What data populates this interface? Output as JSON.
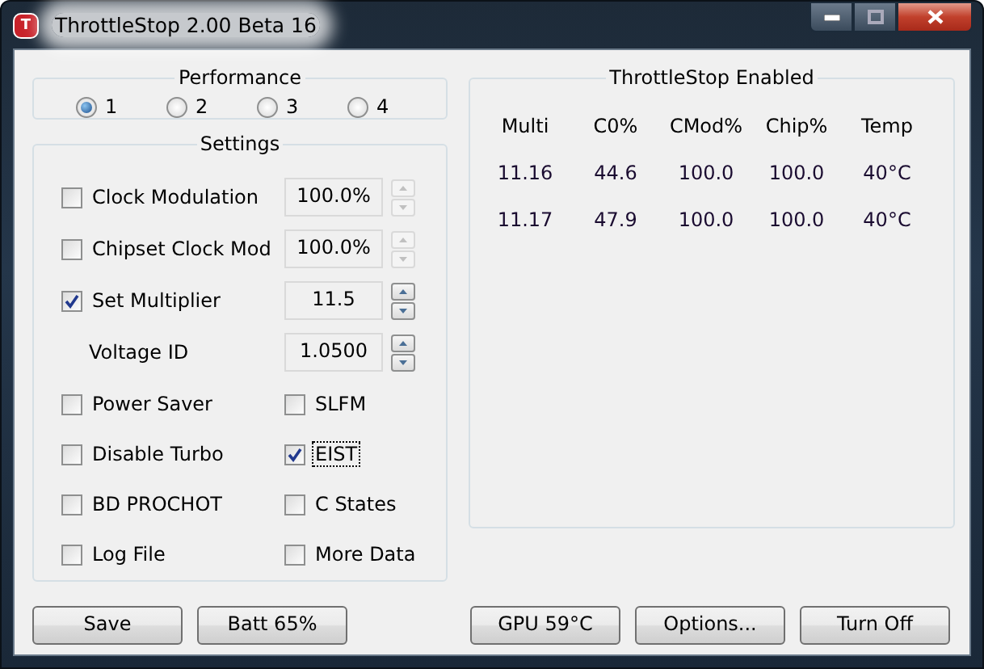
{
  "window": {
    "title": "ThrottleStop 2.00 Beta 16",
    "app_icon_text": "T"
  },
  "performance": {
    "title": "Performance",
    "options": [
      {
        "label": "1",
        "selected": true
      },
      {
        "label": "2",
        "selected": false
      },
      {
        "label": "3",
        "selected": false
      },
      {
        "label": "4",
        "selected": false
      }
    ]
  },
  "settings": {
    "title": "Settings",
    "rows": [
      {
        "kind": "checkbox",
        "label": "Clock Modulation",
        "checked": false,
        "value": "100.0%",
        "spinner_enabled": false
      },
      {
        "kind": "checkbox",
        "label": "Chipset Clock Mod",
        "checked": false,
        "value": "100.0%",
        "spinner_enabled": false
      },
      {
        "kind": "checkbox",
        "label": "Set Multiplier",
        "checked": true,
        "value": "11.5",
        "spinner_enabled": true
      },
      {
        "kind": "label",
        "label": "Voltage ID",
        "value": "1.0500",
        "spinner_enabled": true
      }
    ],
    "toggles": [
      {
        "label": "Power Saver",
        "checked": false,
        "focused": false
      },
      {
        "label": "SLFM",
        "checked": false,
        "focused": false
      },
      {
        "label": "Disable Turbo",
        "checked": false,
        "focused": false
      },
      {
        "label": "EIST",
        "checked": true,
        "focused": true
      },
      {
        "label": "BD PROCHOT",
        "checked": false,
        "focused": false
      },
      {
        "label": "C States",
        "checked": false,
        "focused": false
      },
      {
        "label": "Log File",
        "checked": false,
        "focused": false
      },
      {
        "label": "More Data",
        "checked": false,
        "focused": false
      }
    ]
  },
  "status": {
    "title": "ThrottleStop Enabled",
    "columns": [
      "Multi",
      "C0%",
      "CMod%",
      "Chip%",
      "Temp"
    ],
    "rows": [
      [
        "11.16",
        "44.6",
        "100.0",
        "100.0",
        "40°C"
      ],
      [
        "11.17",
        "47.9",
        "100.0",
        "100.0",
        "40°C"
      ]
    ]
  },
  "buttons_left": [
    "Save",
    "Batt 65%"
  ],
  "buttons_right": [
    "GPU 59°C",
    "Options...",
    "Turn Off"
  ]
}
